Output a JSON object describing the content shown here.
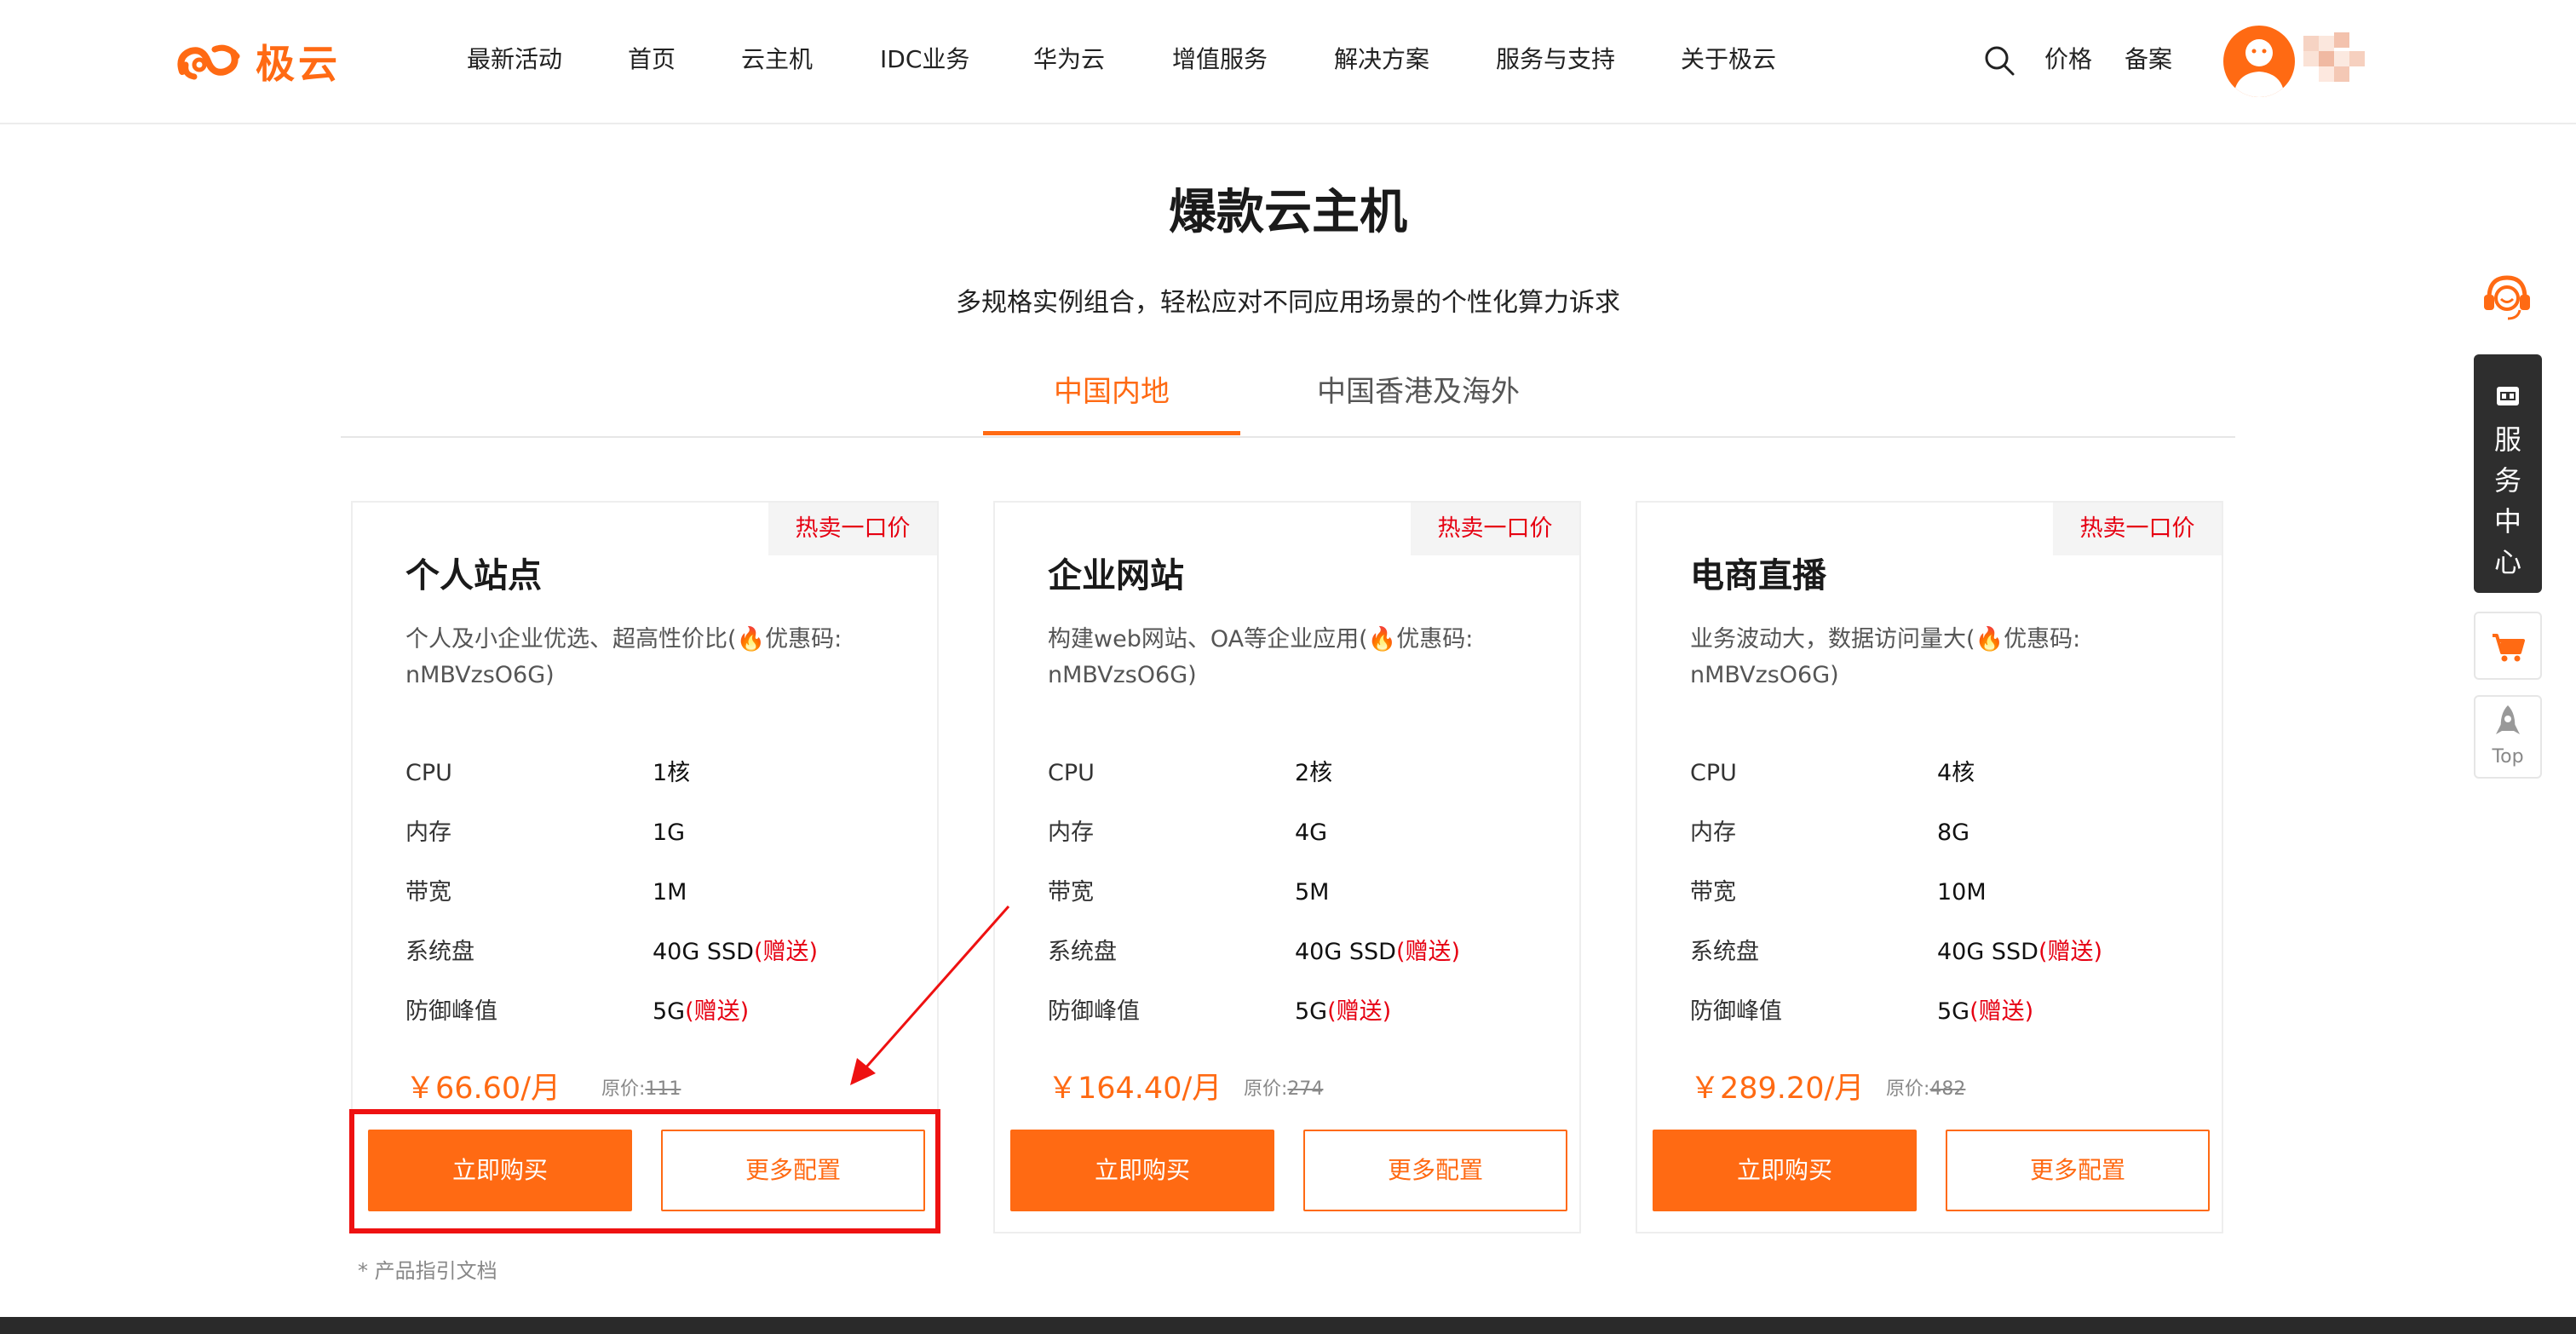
{
  "header": {
    "logo_text": "极云",
    "nav": [
      "最新活动",
      "首页",
      "云主机",
      "IDC业务",
      "华为云",
      "增值服务",
      "解决方案",
      "服务与支持",
      "关于极云"
    ],
    "links": [
      "价格",
      "备案"
    ]
  },
  "section": {
    "title": "爆款云主机",
    "subtitle": "多规格实例组合，轻松应对不同应用场景的个性化算力诉求",
    "tabs": [
      {
        "label": "中国内地",
        "active": true
      },
      {
        "label": "中国香港及海外",
        "active": false
      }
    ]
  },
  "cards": [
    {
      "badge": "热卖一口价",
      "title": "个人站点",
      "desc_line1_a": "个人及小企业优选、超高性价比(",
      "desc_line1_b": "优惠码:",
      "desc_line2": "nMBVzsO6G)",
      "specs": [
        {
          "label": "CPU",
          "value": "1核",
          "gift": ""
        },
        {
          "label": "内存",
          "value": "1G",
          "gift": ""
        },
        {
          "label": "带宽",
          "value": "1M",
          "gift": ""
        },
        {
          "label": "系统盘",
          "value": "40G  SSD",
          "gift": "(赠送)"
        },
        {
          "label": "防御峰值",
          "value": "5G",
          "gift": "(赠送)"
        }
      ],
      "price": "￥66.60/月",
      "orig_label": "原价:",
      "orig_value": "111",
      "buy_label": "立即购买",
      "more_label": "更多配置"
    },
    {
      "badge": "热卖一口价",
      "title": "企业网站",
      "desc_line1_a": "构建web网站、OA等企业应用(",
      "desc_line1_b": "优惠码:",
      "desc_line2": "nMBVzsO6G)",
      "specs": [
        {
          "label": "CPU",
          "value": "2核",
          "gift": ""
        },
        {
          "label": "内存",
          "value": "4G",
          "gift": ""
        },
        {
          "label": "带宽",
          "value": "5M",
          "gift": ""
        },
        {
          "label": "系统盘",
          "value": "40G  SSD",
          "gift": "(赠送)"
        },
        {
          "label": "防御峰值",
          "value": "5G",
          "gift": "(赠送)"
        }
      ],
      "price": "￥164.40/月",
      "orig_label": "原价:",
      "orig_value": "274",
      "buy_label": "立即购买",
      "more_label": "更多配置"
    },
    {
      "badge": "热卖一口价",
      "title": "电商直播",
      "desc_line1_a": "业务波动大，数据访问量大(",
      "desc_line1_b": "优惠码:",
      "desc_line2": "nMBVzsO6G)",
      "specs": [
        {
          "label": "CPU",
          "value": "4核",
          "gift": ""
        },
        {
          "label": "内存",
          "value": "8G",
          "gift": ""
        },
        {
          "label": "带宽",
          "value": "10M",
          "gift": ""
        },
        {
          "label": "系统盘",
          "value": "40G  SSD",
          "gift": "(赠送)"
        },
        {
          "label": "防御峰值",
          "value": "5G",
          "gift": "(赠送)"
        }
      ],
      "price": "￥289.20/月",
      "orig_label": "原价:",
      "orig_value": "482",
      "buy_label": "立即购买",
      "more_label": "更多配置"
    }
  ],
  "doc_link": "* 产品指引文档",
  "float_bar": {
    "service_text": [
      "服",
      "务",
      "中",
      "心"
    ],
    "top_label": "Top"
  },
  "colors": {
    "accent": "#ff6a13",
    "gift_red": "#e60012",
    "annotation_red": "#ee1111",
    "float_dark": "#2e2e2e"
  },
  "icons": [
    "logo-icon",
    "search-icon",
    "avatar-icon",
    "support-agent-icon",
    "kiosk-icon",
    "cart-icon",
    "rocket-icon",
    "fire-icon"
  ]
}
